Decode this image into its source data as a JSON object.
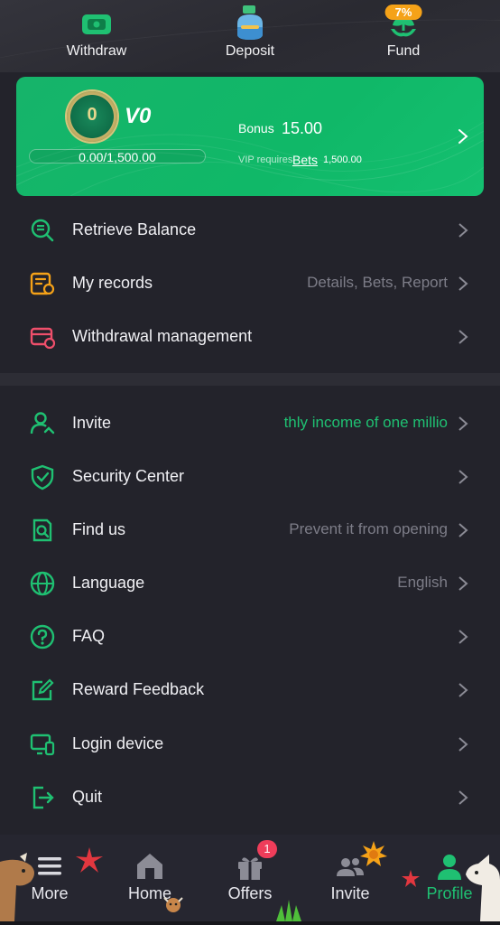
{
  "top_actions": [
    {
      "label": "Withdraw",
      "icon": "wallet-icon"
    },
    {
      "label": "Deposit",
      "icon": "money-bag-icon"
    },
    {
      "label": "Fund",
      "icon": "fund-plant-icon",
      "badge": "7%"
    }
  ],
  "vip": {
    "level": "V0",
    "progress_text": "0.00/1,500.00",
    "progress": 0.0,
    "bonus_label": "Bonus",
    "bonus_value": "15.00",
    "requires_label": "VIP requires",
    "bets_label": "Bets",
    "bets_amount": "1,500.00"
  },
  "menu_group_1": [
    {
      "label": "Retrieve Balance",
      "value": "",
      "icon": "retrieve-balance-icon"
    },
    {
      "label": "My records",
      "value": "Details, Bets, Report",
      "icon": "records-icon"
    },
    {
      "label": "Withdrawal management",
      "value": "",
      "icon": "withdrawal-card-icon"
    }
  ],
  "menu_group_2": [
    {
      "label": "Invite",
      "value": "thly income of one millio",
      "icon": "invite-user-icon"
    },
    {
      "label": "Security Center",
      "value": "",
      "icon": "shield-icon"
    },
    {
      "label": "Find us",
      "value": "Prevent it from opening",
      "icon": "find-us-icon"
    },
    {
      "label": "Language",
      "value": "English",
      "icon": "globe-icon"
    },
    {
      "label": "FAQ",
      "value": "",
      "icon": "question-icon"
    },
    {
      "label": "Reward Feedback",
      "value": "",
      "icon": "edit-icon"
    },
    {
      "label": "Login device",
      "value": "",
      "icon": "device-icon"
    },
    {
      "label": "Quit",
      "value": "",
      "icon": "exit-icon"
    }
  ],
  "bottom_nav": [
    {
      "label": "More",
      "icon": "menu-icon"
    },
    {
      "label": "Home",
      "icon": "home-icon"
    },
    {
      "label": "Offers",
      "icon": "gift-icon",
      "badge": "1"
    },
    {
      "label": "Invite",
      "icon": "users-icon"
    },
    {
      "label": "Profile",
      "icon": "profile-icon",
      "active": true
    }
  ],
  "colors": {
    "accent": "#1fc072",
    "background": "#23232b",
    "card": "#16b46a",
    "badge": "#ef3d5a",
    "fund_badge": "#f5a218"
  }
}
